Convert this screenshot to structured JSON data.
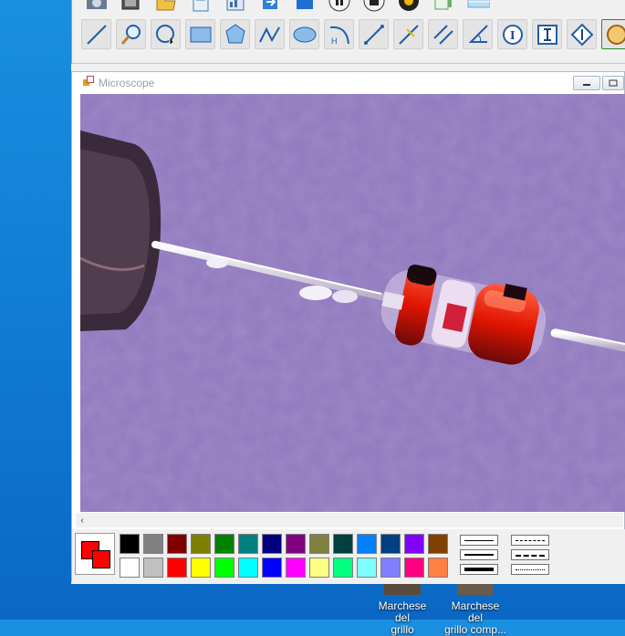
{
  "window": {
    "title": "Microscope"
  },
  "toolbar": {
    "row2_tools": [
      "line-tool",
      "magnifier-tool",
      "circle-select-tool",
      "rectangle-tool",
      "polygon-tool",
      "polyline-tool",
      "ellipse-tool",
      "arc-tool",
      "measure-line-tool",
      "angle-line-tool",
      "parallel-line-tool",
      "angle-tool",
      "text-tool",
      "vertical-measure-tool",
      "height-tool",
      "color-tool"
    ]
  },
  "palette": {
    "primary_color": "#ff0000",
    "secondary_color": "#ff0000",
    "row1": [
      "#000000",
      "#808080",
      "#800000",
      "#808000",
      "#008000",
      "#008080",
      "#000080",
      "#800080",
      "#808040",
      "#004040",
      "#0080ff",
      "#004080",
      "#8000ff",
      "#804000"
    ],
    "row2": [
      "#ffffff",
      "#c0c0c0",
      "#ff0000",
      "#ffff00",
      "#00ff00",
      "#00ffff",
      "#0000ff",
      "#ff00ff",
      "#ffff80",
      "#00ff80",
      "#80ffff",
      "#8080ff",
      "#ff0080",
      "#ff8040"
    ],
    "line_styles": [
      "solid-thin",
      "solid-medium",
      "solid-thick",
      "dashed",
      "dash-dot",
      "dotted"
    ]
  },
  "desktop": {
    "icons": [
      {
        "label1": "Marchese del",
        "label2": "grillo"
      },
      {
        "label1": "Marchese del",
        "label2": "grillo comp..."
      }
    ]
  }
}
